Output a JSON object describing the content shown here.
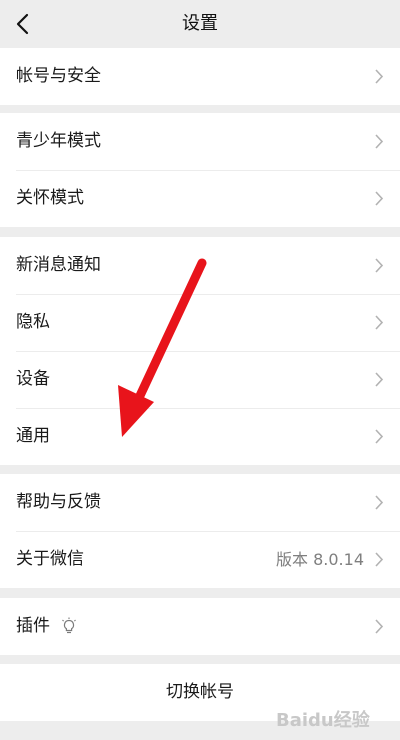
{
  "nav": {
    "title": "设置"
  },
  "groups": [
    {
      "items": [
        {
          "label": "帐号与安全"
        }
      ]
    },
    {
      "items": [
        {
          "label": "青少年模式"
        },
        {
          "label": "关怀模式"
        }
      ]
    },
    {
      "items": [
        {
          "label": "新消息通知"
        },
        {
          "label": "隐私"
        },
        {
          "label": "设备"
        },
        {
          "label": "通用"
        }
      ]
    },
    {
      "items": [
        {
          "label": "帮助与反馈"
        },
        {
          "label": "关于微信",
          "value": "版本 8.0.14"
        }
      ]
    },
    {
      "items": [
        {
          "label": "插件",
          "icon": "bulb-icon"
        }
      ]
    }
  ],
  "switch_account": {
    "label": "切换帐号"
  },
  "colors": {
    "background": "#ededed",
    "cell_background": "#ffffff",
    "annotation_arrow": "#e8141b"
  },
  "watermark": {
    "text": "Baidu经验"
  }
}
